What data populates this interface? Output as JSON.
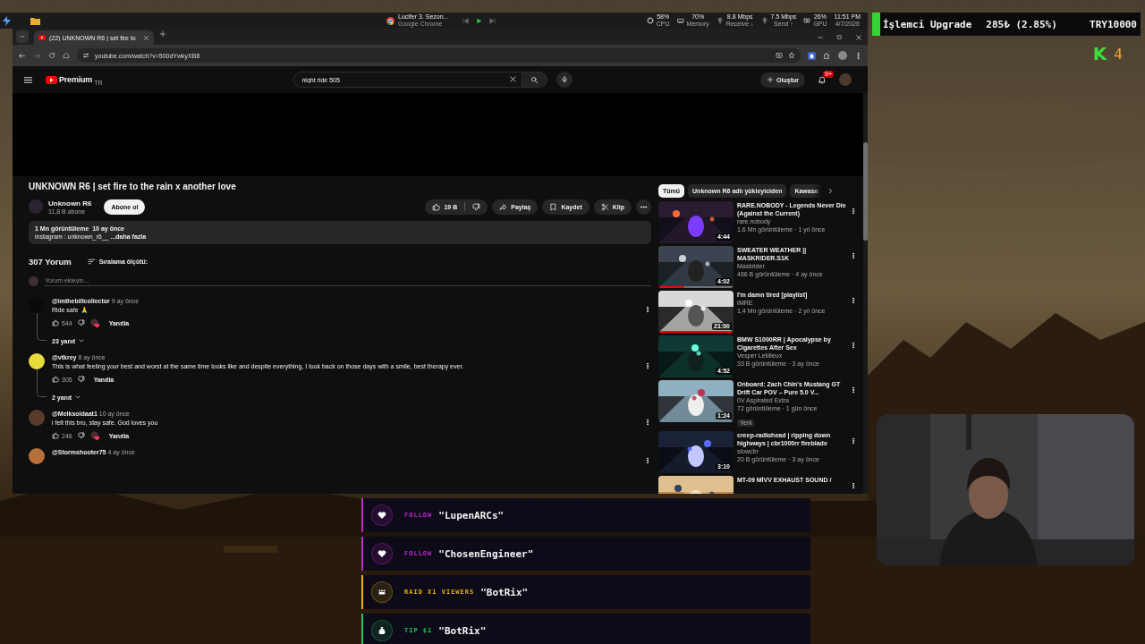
{
  "system_bar": {
    "media": {
      "title": "Lucifer 3. Sezon...",
      "source": "Google Chrome"
    },
    "stats": [
      {
        "kind": "cpu",
        "value": "58%",
        "label": "CPU"
      },
      {
        "kind": "memory",
        "value": "70%",
        "label": "Memory"
      },
      {
        "kind": "network",
        "value": "8.8 Mbps",
        "label": "Receive ↓"
      },
      {
        "kind": "network",
        "value": "7.5 Mbps",
        "label": "Send ↑"
      },
      {
        "kind": "gpu",
        "value": "26%",
        "label": "GPU"
      }
    ],
    "time": "11:51 PM",
    "date": "4/7/2026"
  },
  "browser": {
    "tabs": [
      {
        "title": "(22) UNKNOWN R6 | set fire to",
        "selected": true
      }
    ],
    "url": "youtube.com/watch?v=500dYwkyXB8"
  },
  "youtube": {
    "header": {
      "logo": "Premium",
      "country": "TR",
      "search": "night ride 505",
      "create": "Oluştur",
      "notifications": "9+"
    },
    "video": {
      "title": "UNKNOWN R6 | set fire to the rain x another love",
      "channel": "Unknown R6",
      "subscribers": "11,8 B abone",
      "subscribe": "Abone ol",
      "likes": "19 B",
      "actions": [
        {
          "kind": "share",
          "label": "Paylaş"
        },
        {
          "kind": "save",
          "label": "Kaydet"
        },
        {
          "kind": "clip",
          "label": "Klip"
        }
      ],
      "description": {
        "stats": "1 Mn görüntüleme  10 ay önce",
        "text": "instagram : unknown_r6__ ",
        "more": "...daha fazla"
      }
    },
    "comments": {
      "count": "307 Yorum",
      "sort": "Sıralama ölçütü:",
      "placeholder": "Yorum ekleyin...",
      "items": [
        {
          "author": "@imthebillcollector",
          "time": "9 ay önce",
          "text": "Ride safe 🙏",
          "likes": "544",
          "hearted": true,
          "reply": "Yanıtla",
          "replies": "23 yanıt"
        },
        {
          "author": "@vtkrey",
          "time": "8 ay önce",
          "text": "This is what feeling your best and worst at the same time looks like and despite everything, I look back on those days with a smile, best therapy ever.",
          "likes": "305",
          "hearted": false,
          "reply": "Yanıtla",
          "replies": "2 yanıt"
        },
        {
          "author": "@Melksoldaat1",
          "time": "10 ay önce",
          "text": "i felt this bro, stay safe. God loves you",
          "likes": "246",
          "hearted": true,
          "reply": "Yanıtla"
        },
        {
          "author": "@Stormshooter75",
          "time": "4 ay önce"
        }
      ]
    },
    "chips": [
      {
        "label": "Tümü",
        "selected": true
      },
      {
        "label": "Unknown R6 adlı yükleyiciden",
        "selected": false
      },
      {
        "label": "Kawasa",
        "selected": false
      }
    ],
    "recommendations": [
      {
        "title": "RARE.NOBODY - Legends Never Die (Against the Current)",
        "channel": "rare.nobody",
        "meta": "1,6 Mn görüntüleme · 1 yıl önce",
        "duration": "4:44"
      },
      {
        "title": "SWEATER WEATHER || MASKRIDER.S1K",
        "channel": "Maskrider",
        "meta": "466 B görüntüleme · 4 ay önce",
        "duration": "4:02",
        "level": 0.35
      },
      {
        "title": "I'm damn tired [playlist]",
        "channel": "IMRE",
        "meta": "1,4 Mn görüntüleme · 2 yıl önce",
        "duration": "21:00",
        "level": 1
      },
      {
        "title": "BMW S1000RR | Apocalypse by Cigarettes After Sex",
        "channel": "Vesper LeMieux",
        "meta": "33 B görüntüleme · 3 ay önce",
        "duration": "4:52"
      },
      {
        "title": "Onboard: Zach Chin's Mustang GT Drift Car POV – Pure 5.0 V...",
        "channel": "0V Aspirated Extra",
        "meta": "72 görüntüleme · 1 gün önce",
        "duration": "1:24",
        "badge": "Yeni"
      },
      {
        "title": "creep-radiohead | ripping down highways | cbr1000rr fireblade",
        "channel": "slowcbr",
        "meta": "20 B görüntüleme · 3 ay önce",
        "duration": "3:10"
      },
      {
        "title": "MT-09 MİVV EXHAUST SOUND /"
      }
    ]
  },
  "stream_overlay": {
    "goal": {
      "title": "İşlemci Upgrade",
      "amount": "285₺ (2.85%)",
      "target": "TRY10000",
      "level": 0.0285
    },
    "counter": {
      "logo": "K",
      "value": "4"
    },
    "alerts": [
      {
        "kind": "follow",
        "label": "FOLLOW",
        "name": "\"LupenARCs\"",
        "color": "#c026d3"
      },
      {
        "kind": "follow",
        "label": "FOLLOW",
        "name": "\"ChosenEngineer\"",
        "color": "#c026d3"
      },
      {
        "kind": "raid",
        "label": "RAID X1 VIEWERS",
        "name": "\"BotRix\"",
        "color": "#eab308"
      },
      {
        "kind": "tip",
        "label": "TIP $1",
        "name": "\"BotRix\"",
        "color": "#22c55e"
      }
    ]
  }
}
